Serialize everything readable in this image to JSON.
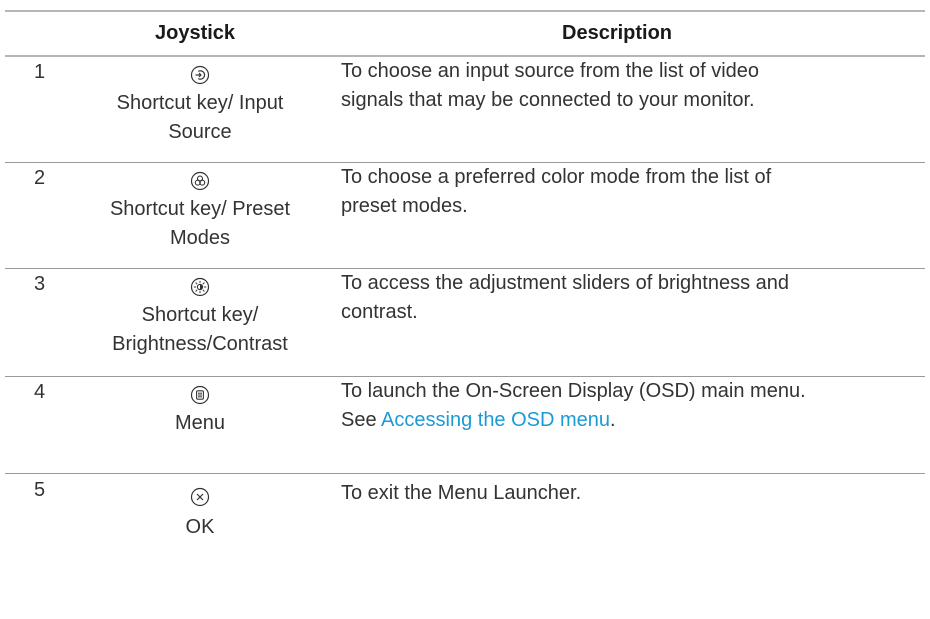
{
  "header": {
    "joystick": "Joystick",
    "description": "Description"
  },
  "rows": [
    {
      "num": "1",
      "icon": "input-source-icon",
      "label_line1": "Shortcut key/ Input",
      "label_line2": "Source",
      "desc_line1": "To choose an input source from the list of video",
      "desc_line2": "signals that may be connected to your monitor."
    },
    {
      "num": "2",
      "icon": "preset-modes-icon",
      "label_line1": "Shortcut key/ Preset",
      "label_line2": "Modes",
      "desc_line1": "To choose a preferred color mode from the list of",
      "desc_line2": "preset modes."
    },
    {
      "num": "3",
      "icon": "brightness-contrast-icon",
      "label_line1": "Shortcut key/",
      "label_line2": "Brightness/Contrast",
      "desc_line1": "To access the adjustment sliders of brightness and",
      "desc_line2": "contrast."
    },
    {
      "num": "4",
      "icon": "menu-icon",
      "label_line1": "Menu",
      "desc_line1": "To launch the On-Screen Display (OSD) main menu.",
      "desc_prefix": "See ",
      "desc_link": "Accessing the OSD menu",
      "desc_suffix": "."
    },
    {
      "num": "5",
      "icon": "exit-icon",
      "label_line1": "OK",
      "desc_line1": "To exit the Menu Launcher."
    }
  ],
  "colors": {
    "link": "#1b9ad6",
    "rule": "#b6b6b6",
    "text": "#333333"
  }
}
